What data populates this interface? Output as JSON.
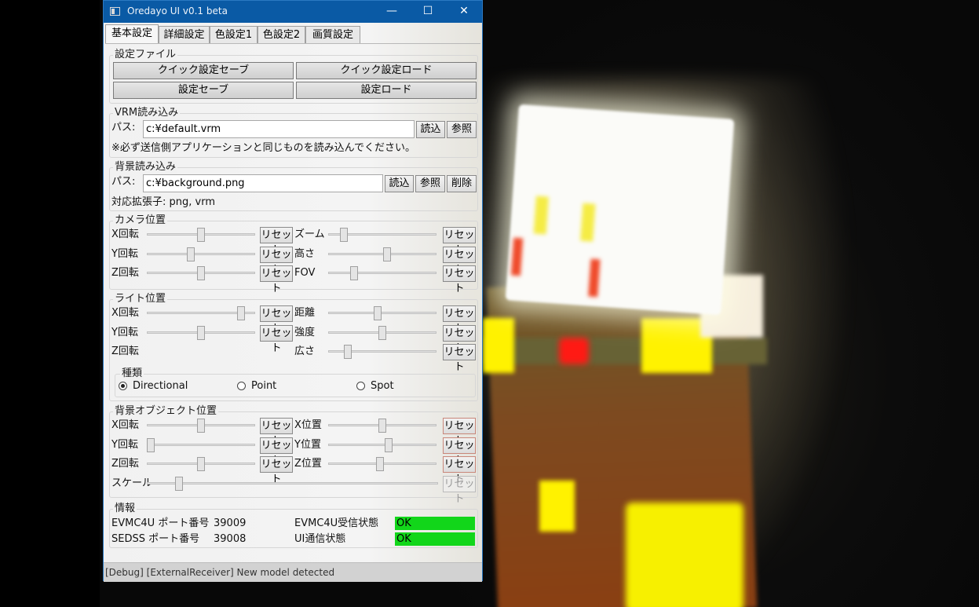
{
  "window": {
    "title": "Oredayo UI v0.1 beta",
    "controls": {
      "minimize": "—",
      "maximize": "☐",
      "close": "✕"
    }
  },
  "tabs": [
    {
      "label": "基本設定",
      "active": true
    },
    {
      "label": "詳細設定",
      "active": false
    },
    {
      "label": "色設定1",
      "active": false
    },
    {
      "label": "色設定2",
      "active": false
    },
    {
      "label": "画質設定",
      "active": false
    }
  ],
  "settings_file": {
    "title": "設定ファイル",
    "quick_save": "クイック設定セーブ",
    "quick_load": "クイック設定ロード",
    "save": "設定セーブ",
    "load": "設定ロード"
  },
  "vrm": {
    "title": "VRM読み込み",
    "path_label": "パス:",
    "path_value": "c:¥default.vrm",
    "load": "読込",
    "browse": "参照",
    "note": "※必ず送信側アプリケーションと同じものを読み込んでください。"
  },
  "background": {
    "title": "背景読み込み",
    "path_label": "パス:",
    "path_value": "c:¥background.png",
    "load": "読込",
    "browse": "参照",
    "delete": "削除",
    "ext": "対応拡張子: png, vrm"
  },
  "reset_label": "リセット",
  "camera": {
    "title": "カメラ位置",
    "left": [
      {
        "label": "X回転",
        "value": 0.5
      },
      {
        "label": "Y回転",
        "value": 0.4
      },
      {
        "label": "Z回転",
        "value": 0.5
      }
    ],
    "right": [
      {
        "label": "ズーム",
        "value": 0.12
      },
      {
        "label": "高さ",
        "value": 0.55
      },
      {
        "label": "FOV",
        "value": 0.22
      }
    ]
  },
  "light": {
    "title": "ライト位置",
    "left": [
      {
        "label": "X回転",
        "value": 0.9
      },
      {
        "label": "Y回転",
        "value": 0.5
      },
      {
        "label": "Z回転",
        "value": null
      }
    ],
    "right": [
      {
        "label": "距離",
        "value": 0.45
      },
      {
        "label": "強度",
        "value": 0.5
      },
      {
        "label": "広さ",
        "value": 0.16
      }
    ],
    "type_title": "種類",
    "types": [
      {
        "label": "Directional",
        "selected": true
      },
      {
        "label": "Point",
        "selected": false
      },
      {
        "label": "Spot",
        "selected": false
      }
    ]
  },
  "bgobject": {
    "title": "背景オブジェクト位置",
    "left": [
      {
        "label": "X回転",
        "value": 0.5
      },
      {
        "label": "Y回転",
        "value": 0.0
      },
      {
        "label": "Z回転",
        "value": 0.5
      }
    ],
    "right": [
      {
        "label": "X位置",
        "value": 0.5
      },
      {
        "label": "Y位置",
        "value": 0.56
      },
      {
        "label": "Z位置",
        "value": 0.48
      }
    ],
    "scale": {
      "label": "スケール",
      "value": 0.1
    }
  },
  "info": {
    "title": "情報",
    "evmc_port_label": "EVMC4U ポート番号",
    "evmc_port": "39009",
    "sedss_port_label": "SEDSS ポート番号",
    "sedss_port": "39008",
    "evmc_status_label": "EVMC4U受信状態",
    "evmc_status": "OK",
    "ui_status_label": "UI通信状態",
    "ui_status": "OK",
    "ok_color": "#12d61a"
  },
  "statusbar": {
    "text": "[Debug] [ExternalReceiver] New model detected"
  }
}
